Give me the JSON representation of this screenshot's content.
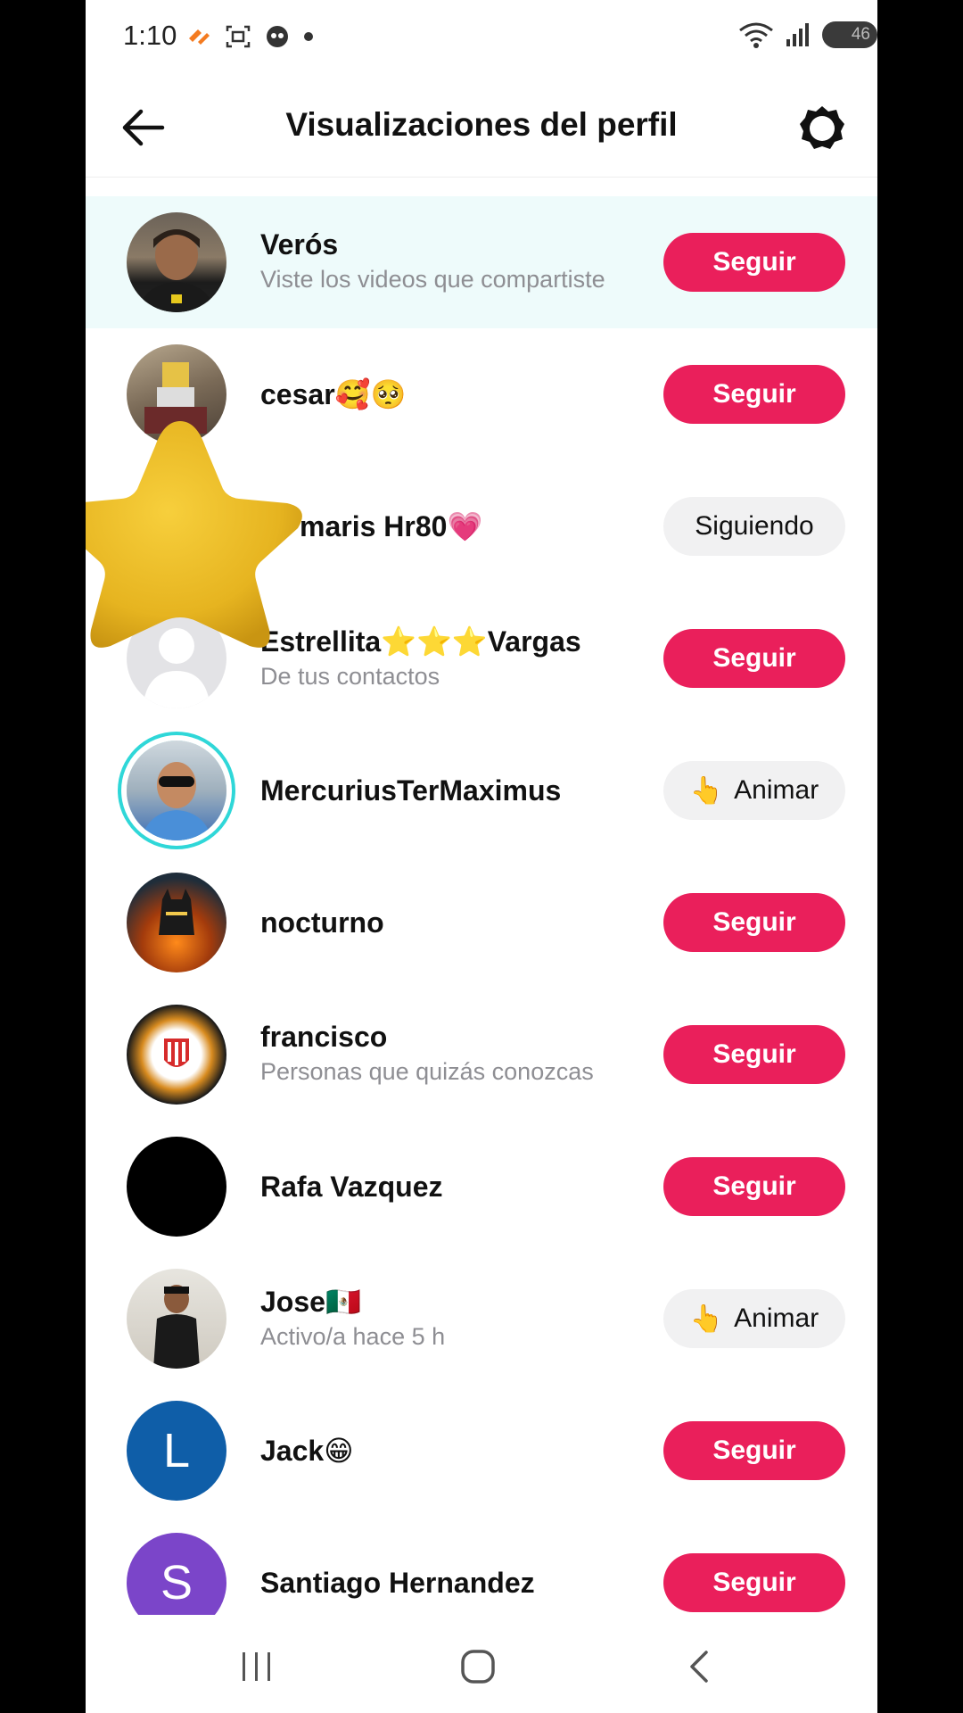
{
  "status_bar": {
    "time": "1:10",
    "battery": "46"
  },
  "header": {
    "title": "Visualizaciones del perfil"
  },
  "rows": [
    {
      "name": "Verós",
      "subtitle": "Viste los videos que compartiste",
      "button": "Seguir"
    },
    {
      "name": "cesar🥰🥺",
      "subtitle": "",
      "button": "Seguir"
    },
    {
      "name": "maris Hr80💗",
      "subtitle": "",
      "button": "Siguiendo"
    },
    {
      "name": "Estrellita⭐⭐⭐Vargas",
      "subtitle": "De tus contactos",
      "button": "Seguir"
    },
    {
      "name": "MercuriusTerMaximus",
      "subtitle": "",
      "button": "Animar",
      "button_emoji": "👆"
    },
    {
      "name": "nocturno",
      "subtitle": "",
      "button": "Seguir"
    },
    {
      "name": "francisco",
      "subtitle": "Personas que quizás conozcas",
      "button": "Seguir"
    },
    {
      "name": "Rafa Vazquez",
      "subtitle": "",
      "button": "Seguir"
    },
    {
      "name": "Jose🇲🇽",
      "subtitle": "Activo/a hace 5 h",
      "button": "Animar",
      "button_emoji": "👆"
    },
    {
      "name": "Jack😁",
      "subtitle": "",
      "button": "Seguir",
      "avatar_letter": "L"
    },
    {
      "name": "Santiago Hernandez",
      "subtitle": "",
      "button": "Seguir",
      "avatar_letter": "S"
    }
  ],
  "colors": {
    "follow": "#ea1f5b",
    "secondary_button": "#f1f1f2",
    "highlight_row": "#eefbfb",
    "story_ring": "#2fd7d8"
  },
  "icons": {
    "back": "arrow-left-icon",
    "settings": "gear-icon",
    "recents": "recents-icon",
    "home": "home-icon",
    "nav_back": "chevron-left-icon"
  }
}
